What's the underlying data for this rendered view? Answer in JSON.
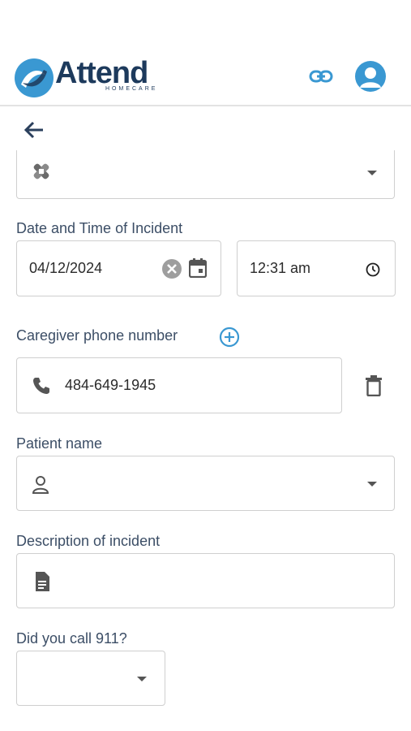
{
  "header": {
    "brand_name": "Attend",
    "brand_sub": "HOMECARE"
  },
  "form": {
    "incident_type": {
      "value": ""
    },
    "date_time": {
      "label": "Date and Time of Incident",
      "date_value": "04/12/2024",
      "time_value": "12:31 am"
    },
    "caregiver_phone": {
      "label": "Caregiver phone number",
      "value": "484-649-1945"
    },
    "patient_name": {
      "label": "Patient name",
      "value": ""
    },
    "description": {
      "label": "Description of incident",
      "value": ""
    },
    "called_911": {
      "label": "Did you call 911?",
      "value": ""
    }
  },
  "colors": {
    "brand_navy": "#1d3a5c",
    "brand_blue": "#3a98d2",
    "label_text": "#3c4e66",
    "border": "#cfcfcf"
  },
  "icons": [
    "attend-logo-icon",
    "link-icon",
    "user-avatar-icon",
    "back-arrow-icon",
    "bandage-icon",
    "clear-circle-icon",
    "calendar-icon",
    "clock-icon",
    "add-circle-icon",
    "phone-icon",
    "trash-icon",
    "person-icon",
    "document-icon",
    "chevron-down-icon"
  ]
}
